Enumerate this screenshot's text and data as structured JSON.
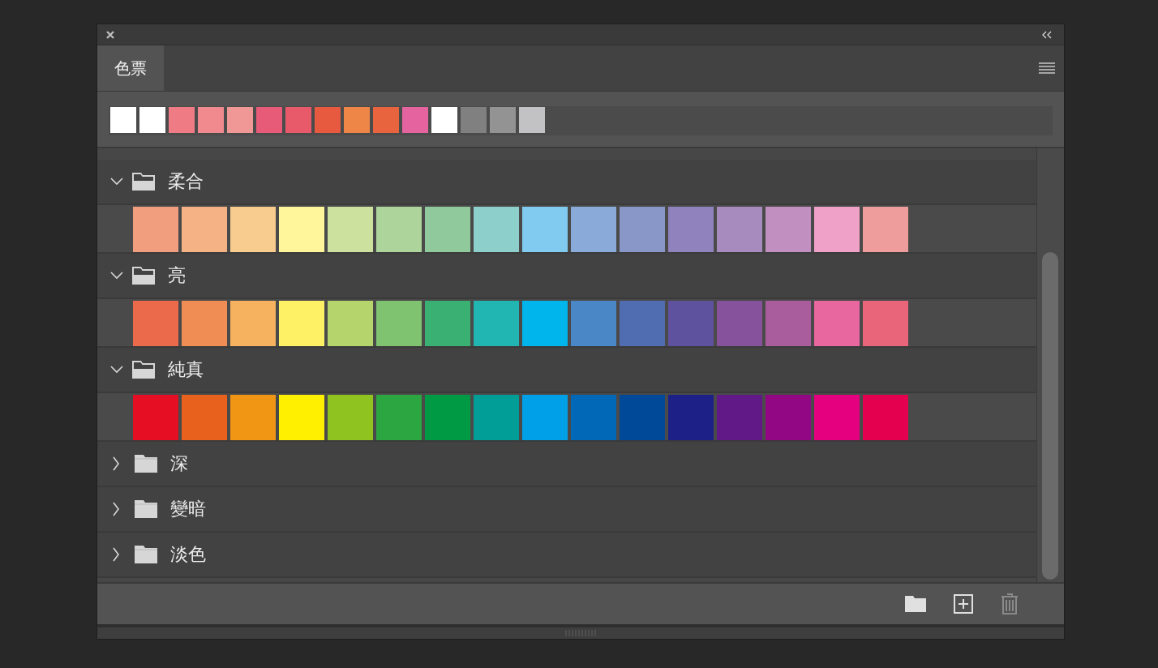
{
  "tab": {
    "label": "色票",
    "selected": true
  },
  "recent_swatches": [
    {
      "color": "#ffffff"
    },
    {
      "color": "#ffffff"
    },
    {
      "color": "#ef7c84"
    },
    {
      "color": "#f08a8e"
    },
    {
      "color": "#ef9896"
    },
    {
      "color": "#e75a78"
    },
    {
      "color": "#e85a6a"
    },
    {
      "color": "#e75a40"
    },
    {
      "color": "#ee8648"
    },
    {
      "color": "#e8643f"
    },
    {
      "color": "#e564a0"
    },
    {
      "color": "#ffffff"
    },
    {
      "color": "#808080"
    },
    {
      "color": "#939393"
    },
    {
      "color": "#c2c2c4"
    }
  ],
  "groups": [
    {
      "name": "柔合",
      "expanded": true,
      "swatches": [
        {
          "color": "#f09e7e"
        },
        {
          "color": "#f4b285"
        },
        {
          "color": "#f8cb8f"
        },
        {
          "color": "#fff59a"
        },
        {
          "color": "#cde19f"
        },
        {
          "color": "#add59b"
        },
        {
          "color": "#8fc99c"
        },
        {
          "color": "#8ccfcb"
        },
        {
          "color": "#82cbf0"
        },
        {
          "color": "#8aabd9"
        },
        {
          "color": "#8896c8"
        },
        {
          "color": "#8f82bd"
        },
        {
          "color": "#a78bbe"
        },
        {
          "color": "#c190c0"
        },
        {
          "color": "#f0a1c8"
        },
        {
          "color": "#ef9c9c"
        }
      ]
    },
    {
      "name": "亮",
      "expanded": true,
      "swatches": [
        {
          "color": "#ec6a4c"
        },
        {
          "color": "#f08d55"
        },
        {
          "color": "#f6b25e"
        },
        {
          "color": "#fff166"
        },
        {
          "color": "#b5d56c"
        },
        {
          "color": "#7fc270"
        },
        {
          "color": "#3bb073"
        },
        {
          "color": "#22b6b3"
        },
        {
          "color": "#00b5eb"
        },
        {
          "color": "#4a87c6"
        },
        {
          "color": "#4f6db0"
        },
        {
          "color": "#5e519d"
        },
        {
          "color": "#86529c"
        },
        {
          "color": "#a95d9d"
        },
        {
          "color": "#e9679f"
        },
        {
          "color": "#e9667a"
        }
      ]
    },
    {
      "name": "純真",
      "expanded": true,
      "swatches": [
        {
          "color": "#e60e23"
        },
        {
          "color": "#e8611d"
        },
        {
          "color": "#f19515"
        },
        {
          "color": "#fff000"
        },
        {
          "color": "#8fc31f"
        },
        {
          "color": "#2ba641"
        },
        {
          "color": "#009944"
        },
        {
          "color": "#009e96"
        },
        {
          "color": "#00a0e9"
        },
        {
          "color": "#0068b7"
        },
        {
          "color": "#004898"
        },
        {
          "color": "#1d2087"
        },
        {
          "color": "#601986"
        },
        {
          "color": "#920783"
        },
        {
          "color": "#e4007f"
        },
        {
          "color": "#e5004f"
        }
      ]
    },
    {
      "name": "深",
      "expanded": false
    },
    {
      "name": "變暗",
      "expanded": false
    },
    {
      "name": "淡色",
      "expanded": false
    }
  ]
}
